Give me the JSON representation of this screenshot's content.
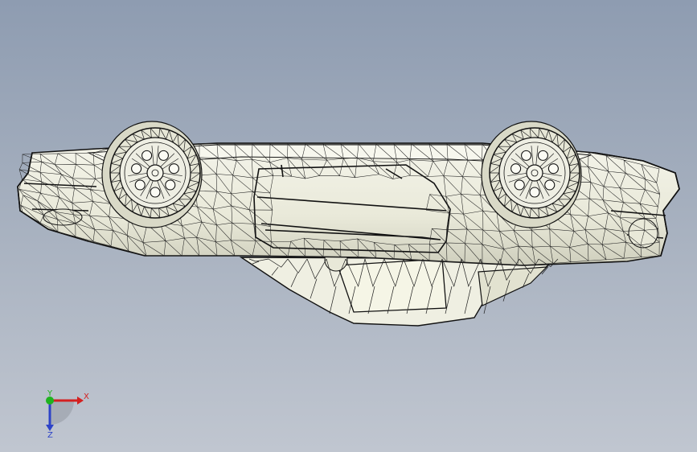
{
  "viewport": {
    "background_top": "#8e9cb1",
    "background_bottom": "#c0c6d0",
    "model": "car-wireframe-upside-down",
    "display_mode": "shaded-with-edges"
  },
  "triad": {
    "x_label": "X",
    "y_label": "Y",
    "z_label": "Z",
    "x_color": "#d42020",
    "y_color": "#1fb31f",
    "z_color": "#2d43c8"
  }
}
